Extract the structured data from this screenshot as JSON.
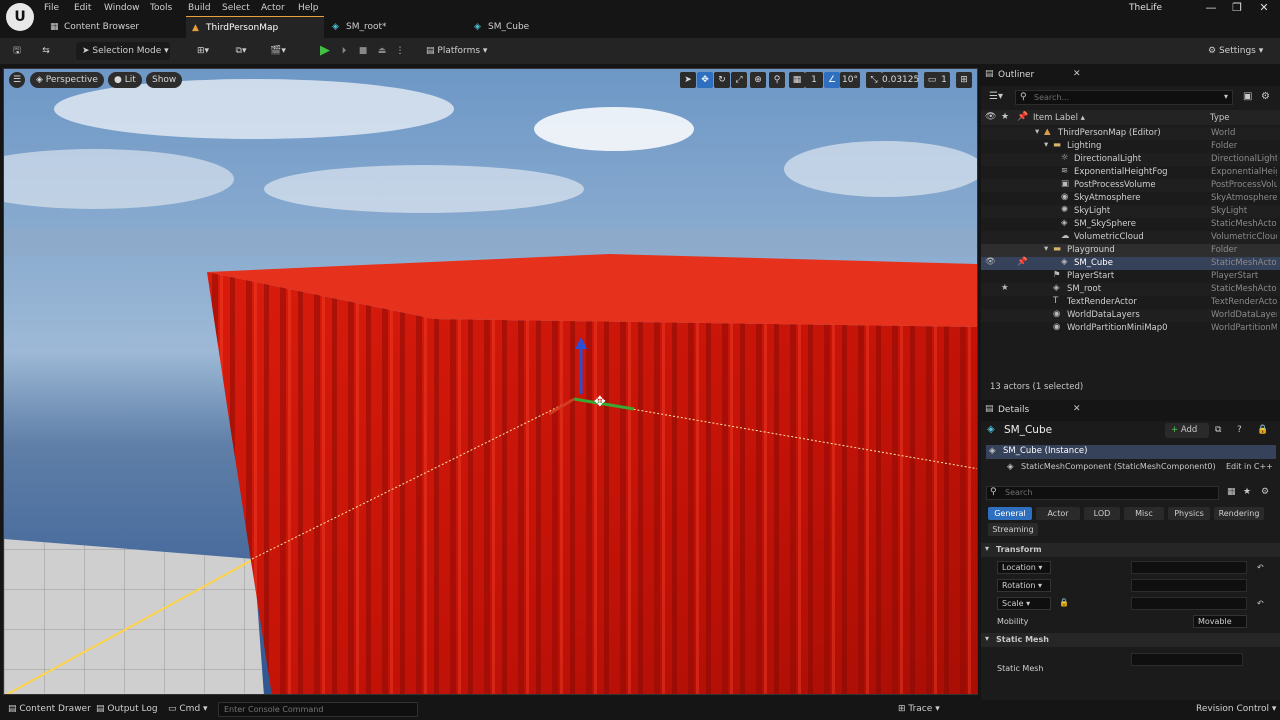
{
  "menu": [
    "File",
    "Edit",
    "Window",
    "Tools",
    "Build",
    "Select",
    "Actor",
    "Help"
  ],
  "app_title": "TheLife",
  "tabs": [
    {
      "label": "Content Browser",
      "active": false
    },
    {
      "label": "ThirdPersonMap",
      "active": true
    },
    {
      "label": "SM_root*",
      "active": false
    },
    {
      "label": "SM_Cube",
      "active": false
    }
  ],
  "toolbar": {
    "selection_mode": "Selection Mode",
    "platforms": "Platforms",
    "settings": "Settings"
  },
  "viewport": {
    "perspective": "Perspective",
    "lit": "Lit",
    "show": "Show",
    "grid_size": "1",
    "rotation_snap": "10°",
    "scale_snap": "0.03125",
    "camera_speed": "1"
  },
  "outliner": {
    "title": "Outliner",
    "search_placeholder": "Search...",
    "col_label": "Item Label ▴",
    "col_type": "Type",
    "status": "13 actors (1 selected)",
    "rows": [
      {
        "label": "ThirdPersonMap (Editor)",
        "type": "World"
      },
      {
        "label": "Lighting",
        "type": "Folder"
      },
      {
        "label": "DirectionalLight",
        "type": "DirectionalLight"
      },
      {
        "label": "ExponentialHeightFog",
        "type": "ExponentialHeightFog"
      },
      {
        "label": "PostProcessVolume",
        "type": "PostProcessVolume"
      },
      {
        "label": "SkyAtmosphere",
        "type": "SkyAtmosphere"
      },
      {
        "label": "SkyLight",
        "type": "SkyLight"
      },
      {
        "label": "SM_SkySphere",
        "type": "StaticMeshActor"
      },
      {
        "label": "VolumetricCloud",
        "type": "VolumetricCloud"
      },
      {
        "label": "Playground",
        "type": "Folder"
      },
      {
        "label": "SM_Cube",
        "type": "StaticMeshActor"
      },
      {
        "label": "PlayerStart",
        "type": "PlayerStart"
      },
      {
        "label": "SM_root",
        "type": "StaticMeshActor"
      },
      {
        "label": "TextRenderActor",
        "type": "TextRenderActor"
      },
      {
        "label": "WorldDataLayers",
        "type": "WorldDataLayers"
      },
      {
        "label": "WorldPartitionMiniMap0",
        "type": "WorldPartitionMiniMap"
      }
    ]
  },
  "details": {
    "title": "Details",
    "object_name": "SM_Cube",
    "add_label": "Add",
    "instance": "SM_Cube (Instance)",
    "component": "StaticMeshComponent (StaticMeshComponent0)",
    "edit_cpp": "Edit in C++",
    "search_placeholder": "Search",
    "tabs": [
      "General",
      "Actor",
      "LOD",
      "Misc",
      "Physics",
      "Rendering",
      "Streaming"
    ],
    "transform_header": "Transform",
    "location": "Location",
    "rotation": "Rotation",
    "scale": "Scale",
    "mobility": "Mobility",
    "mobility_value": "Movable",
    "static_mesh_header": "Static Mesh",
    "static_mesh_label": "Static Mesh"
  },
  "statusbar": {
    "content_drawer": "Content Drawer",
    "output_log": "Output Log",
    "cmd": "Cmd",
    "console_placeholder": "Enter Console Command",
    "trace": "Trace",
    "revision_control": "Revision Control"
  }
}
